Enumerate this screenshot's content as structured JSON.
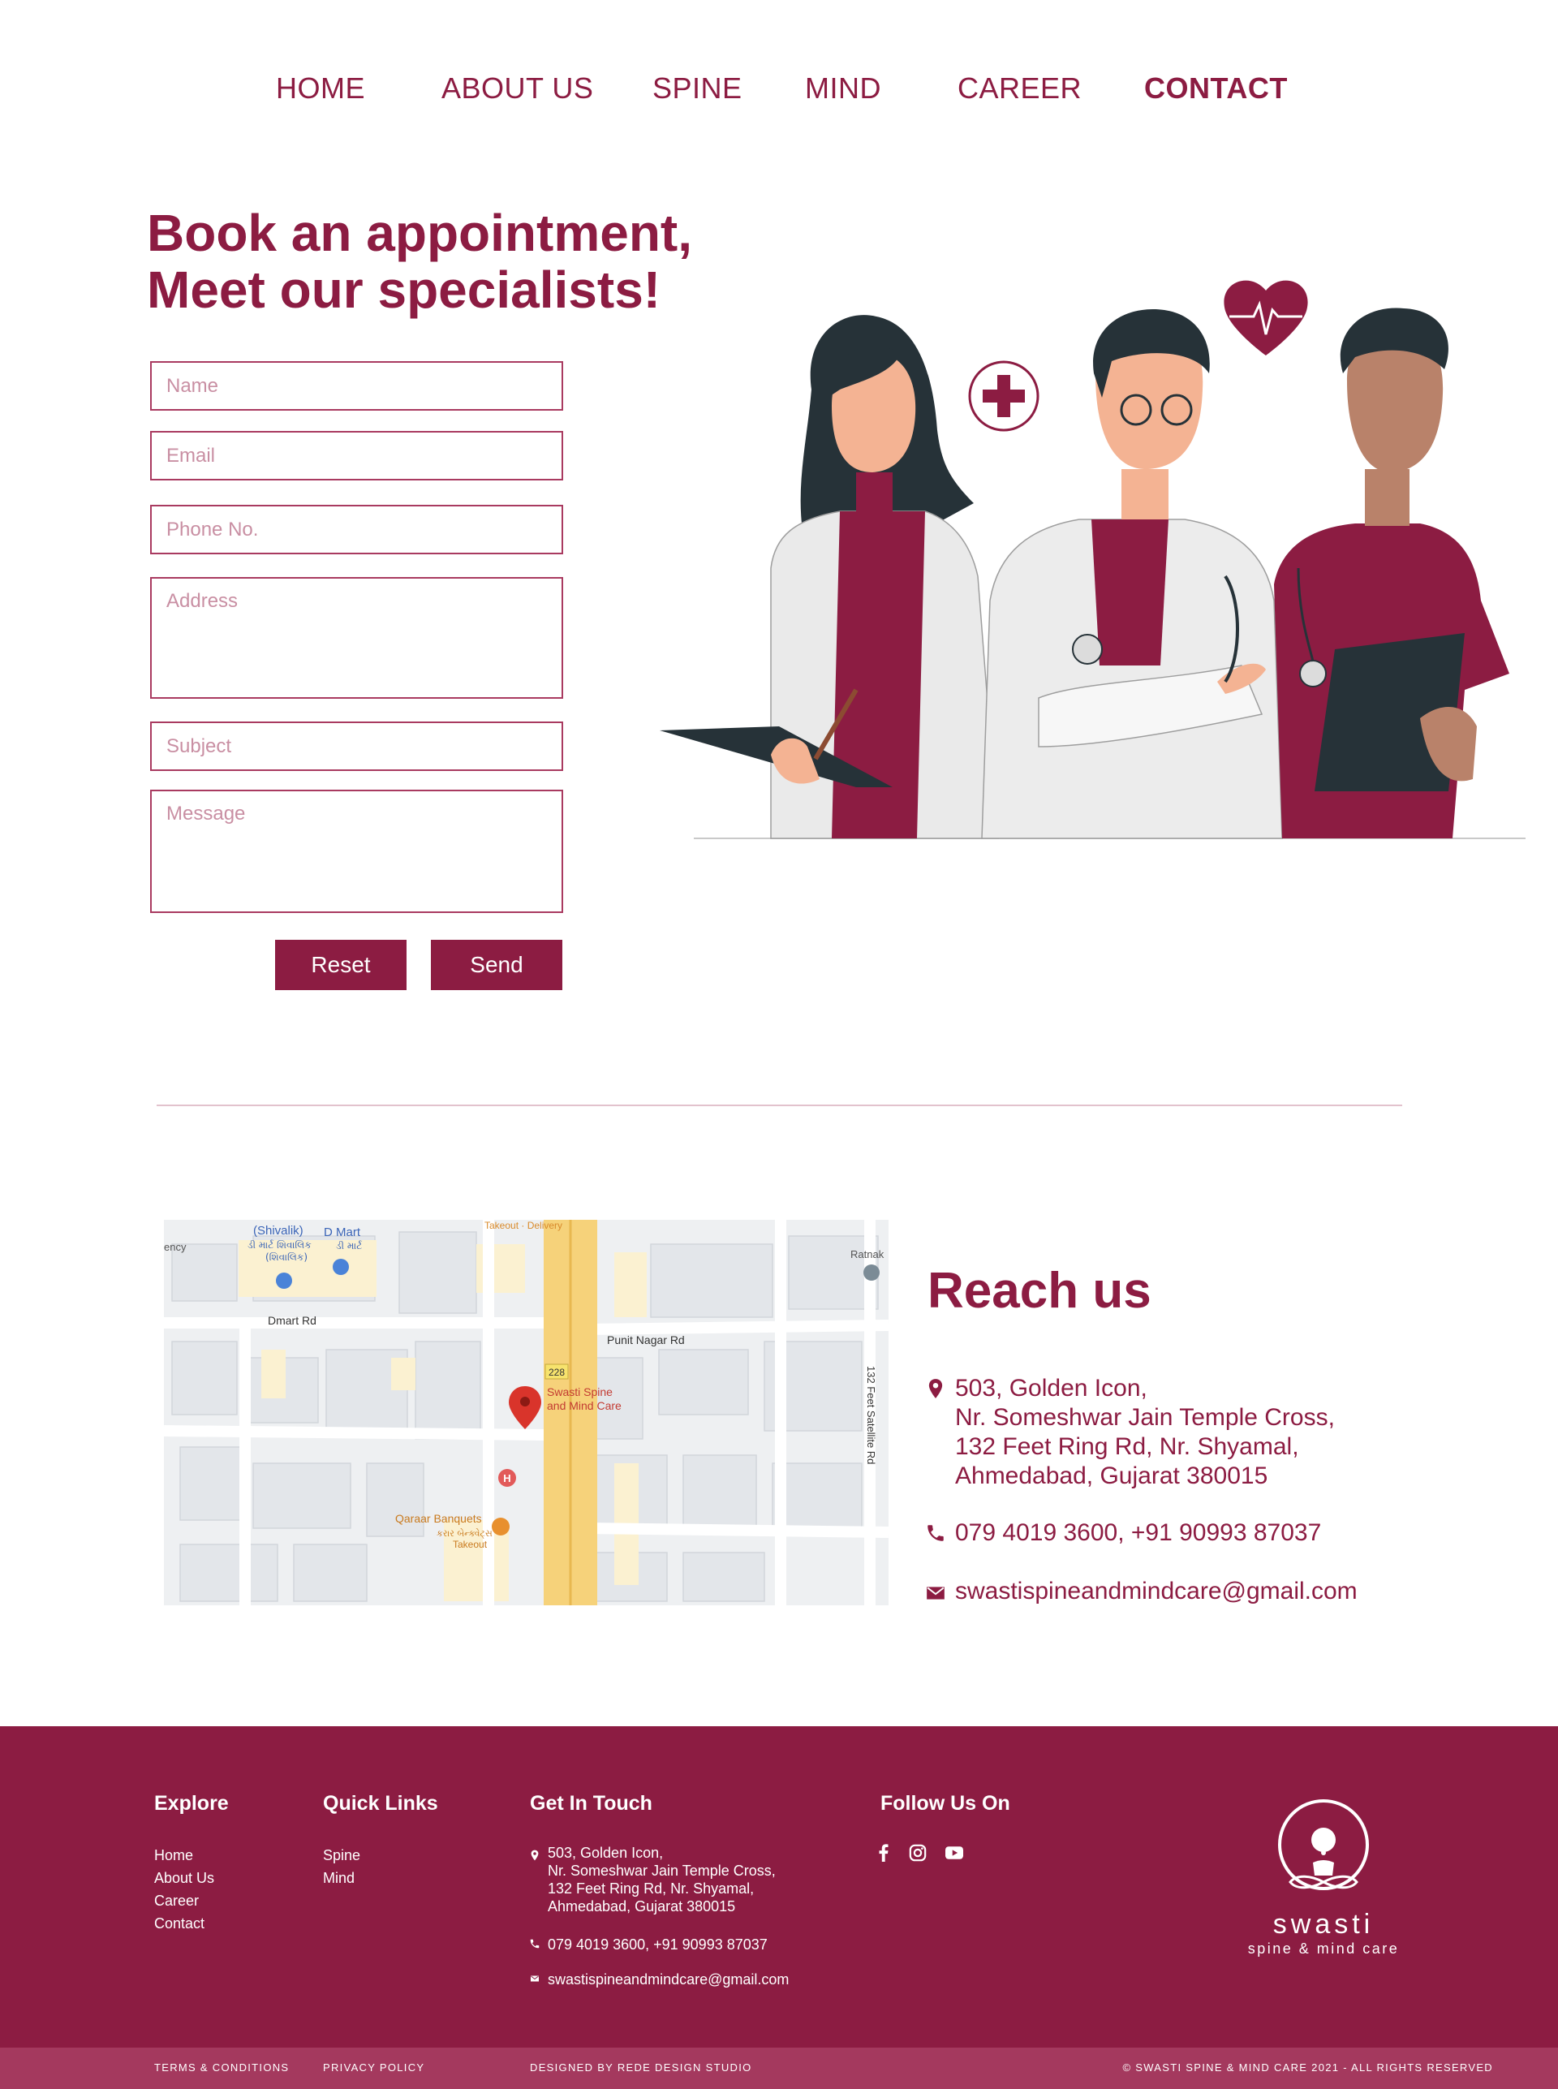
{
  "nav": {
    "items": [
      "HOME",
      "ABOUT US",
      "SPINE",
      "MIND",
      "CAREER",
      "CONTACT"
    ],
    "active": "CONTACT"
  },
  "hero": {
    "title_line1": "Book an appointment,",
    "title_line2": "Meet our specialists!"
  },
  "form": {
    "name_placeholder": "Name",
    "email_placeholder": "Email",
    "phone_placeholder": "Phone No.",
    "address_placeholder": "Address",
    "subject_placeholder": "Subject",
    "message_placeholder": "Message",
    "reset_label": "Reset",
    "send_label": "Send"
  },
  "map": {
    "labels": {
      "shivalik": "(Shivalik)",
      "shivalik_sub1": "ડી માર્ટ શિવાલિક",
      "shivalik_sub2": "(શિવાલિક)",
      "dmart": "D Mart",
      "dmart_sub": "ડી માર્ટ",
      "takeout_top": "Takeout · Delivery",
      "ency": "ency",
      "ratnak": "Ratnak",
      "dmart_rd": "Dmart Rd",
      "punit_nagar": "Punit Nagar Rd",
      "road_number": "228",
      "satellite_rd": "132 Feet Satellite Rd",
      "pin_label_1": "Swasti Spine",
      "pin_label_2": "and Mind Care",
      "qaraar": "Qaraar Banquets",
      "qaraar_sub": "કરાર બેન્ક્વેટ્સ",
      "takeout": "Takeout"
    }
  },
  "reach": {
    "title": "Reach us",
    "address_lines": [
      "503, Golden Icon,",
      "Nr. Someshwar Jain Temple Cross,",
      "132 Feet Ring Rd, Nr. Shyamal,",
      "Ahmedabad, Gujarat 380015"
    ],
    "phone": "079 4019 3600, +91 90993 87037",
    "email": "swastispineandmindcare@gmail.com"
  },
  "footer": {
    "explore_title": "Explore",
    "explore_items": [
      "Home",
      "About Us",
      "Career",
      "Contact"
    ],
    "quick_title": "Quick Links",
    "quick_items": [
      "Spine",
      "Mind"
    ],
    "touch_title": "Get In Touch",
    "touch_address": [
      "503, Golden Icon,",
      "Nr. Someshwar Jain Temple Cross,",
      "132 Feet Ring Rd, Nr. Shyamal,",
      "Ahmedabad, Gujarat 380015"
    ],
    "touch_phone": "079 4019 3600, +91 90993 87037",
    "touch_email": "swastispineandmindcare@gmail.com",
    "follow_title": "Follow Us On",
    "social_icons": [
      "facebook-icon",
      "instagram-icon",
      "youtube-icon"
    ],
    "logo_name": "swasti",
    "logo_tagline": "spine & mind care"
  },
  "bottom_bar": {
    "terms": "TERMS & CONDITIONS",
    "privacy": "PRIVACY POLICY",
    "designed_by": "DESIGNED BY REDE DESIGN STUDIO",
    "copyright": "© SWASTI SPINE & MIND CARE 2021 - ALL RIGHTS RESERVED"
  },
  "colors": {
    "brand": "#8c1c42",
    "brand_light": "#a4395e",
    "divider": "#e2c2cd"
  }
}
